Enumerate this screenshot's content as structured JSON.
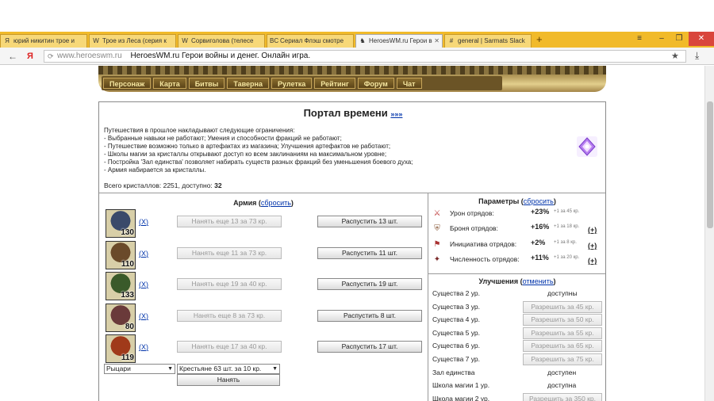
{
  "browser": {
    "tabs": [
      {
        "label": "юрий никитин трое и",
        "icon": "Я",
        "active": false
      },
      {
        "label": "Трое из Леса (серия к",
        "icon": "W",
        "active": false
      },
      {
        "label": "Сорвиголова (телесе",
        "icon": "W",
        "active": false
      },
      {
        "label": "Сериал Флэш смотре",
        "icon": "BC",
        "active": false
      },
      {
        "label": "HeroesWM.ru Герои в",
        "icon": "♞",
        "active": true
      },
      {
        "label": "general | Sarmats Slack",
        "icon": "#",
        "active": false
      }
    ],
    "new_tab": "+",
    "url_host": "www.heroeswm.ru",
    "page_title": "HeroesWM.ru Герои войны и денег. Онлайн игра.",
    "yandex": "Я"
  },
  "menu": [
    "Персонаж",
    "Карта",
    "Битвы",
    "Таверна",
    "Рулетка",
    "Рейтинг",
    "Форум",
    "Чат"
  ],
  "portal": {
    "title": "Портал времени",
    "more": "»»»",
    "intro": [
      "Путешествия в прошлое накладывают следующие ограничения:",
      "- Выбранные навыки не работают; Умения и способности фракций не работают;",
      "- Путешествие возможно только в артефактах из магазина; Улучшения артефактов не работают;",
      "- Школы магии за кристаллы открывают доступ ко всем заклинаниям на максимальном уровне;",
      "- Постройка 'Зал единства' позволяет набирать существ разных фракций без уменьшения боевого духа;",
      "- Армия набирается за кристаллы."
    ],
    "crystals_prefix": "Всего кристаллов: 2251, доступно: ",
    "crystals_available": "32"
  },
  "army": {
    "title": "Армия",
    "reset": "сбросить",
    "units": [
      {
        "count": "130",
        "remove": "X",
        "hire": "Нанять еще 13 за 73 кр.",
        "dismiss": "Распустить 13 шт.",
        "color": "#3a4a6a"
      },
      {
        "count": "110",
        "remove": "X",
        "hire": "Нанять еще 11 за 73 кр.",
        "dismiss": "Распустить 11 шт.",
        "color": "#6a4a2a"
      },
      {
        "count": "133",
        "remove": "X",
        "hire": "Нанять еще 19 за 40 кр.",
        "dismiss": "Распустить 19 шт.",
        "color": "#3a5a2a"
      },
      {
        "count": "80",
        "remove": "X",
        "hire": "Нанять еще 8 за 73 кр.",
        "dismiss": "Распустить 8 шт.",
        "color": "#6a3a3a"
      },
      {
        "count": "119",
        "remove": "X",
        "hire": "Нанять еще 17 за 40 кр.",
        "dismiss": "Распустить 17 шт.",
        "color": "#a03a1a"
      }
    ],
    "faction_select": "Рыцари",
    "unit_select": "Крестьяне 63 шт. за 10 кр.",
    "hire_button": "Нанять"
  },
  "params": {
    "title": "Параметры",
    "reset": "сбросить",
    "rows": [
      {
        "icon": "⚔",
        "label": "Урон отрядов:",
        "value": "+23%",
        "note": "+1 за 45 кр.",
        "plus": ""
      },
      {
        "icon": "⛨",
        "label": "Броня отрядов:",
        "value": "+16%",
        "note": "+1 за 18 кр.",
        "plus": "(+)"
      },
      {
        "icon": "⚑",
        "label": "Инициатива отрядов:",
        "value": "+2%",
        "note": "+1 за 8 кр.",
        "plus": "(+)"
      },
      {
        "icon": "✦",
        "label": "Численность отрядов:",
        "value": "+11%",
        "note": "+1 за 20 кр.",
        "plus": "(+)"
      }
    ]
  },
  "upgrades": {
    "title": "Улучшения",
    "cancel": "отменить",
    "rows": [
      {
        "label": "Существа 2 ур.",
        "status": "доступны",
        "button": ""
      },
      {
        "label": "Существа 3 ур.",
        "status": "",
        "button": "Разрешить за 45 кр."
      },
      {
        "label": "Существа 4 ур.",
        "status": "",
        "button": "Разрешить за 50 кр."
      },
      {
        "label": "Существа 5 ур.",
        "status": "",
        "button": "Разрешить за 55 кр."
      },
      {
        "label": "Существа 6 ур.",
        "status": "",
        "button": "Разрешить за 65 кр."
      },
      {
        "label": "Существа 7 ур.",
        "status": "",
        "button": "Разрешить за 75 кр."
      },
      {
        "label": "Зал единства",
        "status": "доступен",
        "button": ""
      },
      {
        "label": "Школа магии 1 ур.",
        "status": "доступна",
        "button": ""
      },
      {
        "label": "Школа магии 2 ур.",
        "status": "",
        "button": "Разрешить за 350 кр."
      }
    ]
  }
}
